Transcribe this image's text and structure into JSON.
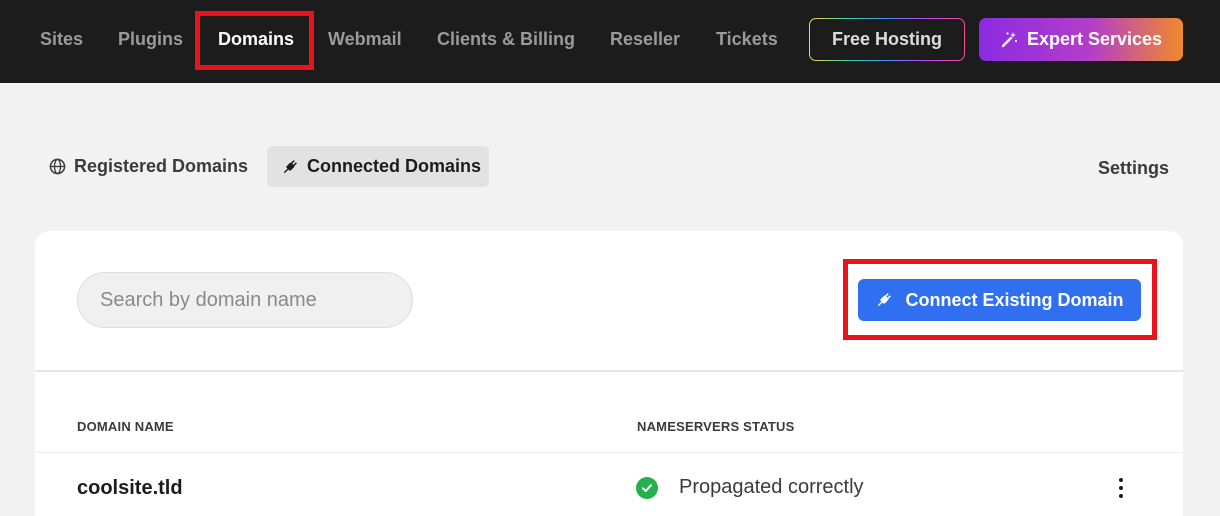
{
  "nav": {
    "items": [
      {
        "label": "Sites"
      },
      {
        "label": "Plugins"
      },
      {
        "label": "Domains"
      },
      {
        "label": "Webmail"
      },
      {
        "label": "Clients & Billing"
      },
      {
        "label": "Reseller"
      },
      {
        "label": "Tickets"
      }
    ],
    "active": "Domains",
    "free_hosting_label": "Free Hosting",
    "expert_services_label": "Expert Services"
  },
  "subnav": {
    "registered_label": "Registered Domains",
    "connected_label": "Connected Domains",
    "settings_label": "Settings"
  },
  "toolbar": {
    "search_placeholder": "Search by domain name",
    "connect_label": "Connect Existing Domain"
  },
  "table": {
    "columns": [
      "DOMAIN NAME",
      "NAMESERVERS STATUS"
    ],
    "rows": [
      {
        "domain": "coolsite.tld",
        "status": "Propagated correctly",
        "status_icon": "check-circle-icon"
      }
    ]
  },
  "colors": {
    "accent_blue": "#2f6ff0",
    "highlight_red": "#e8141c",
    "success_green": "#22b14c",
    "topbar_bg": "#1c1c1c"
  }
}
